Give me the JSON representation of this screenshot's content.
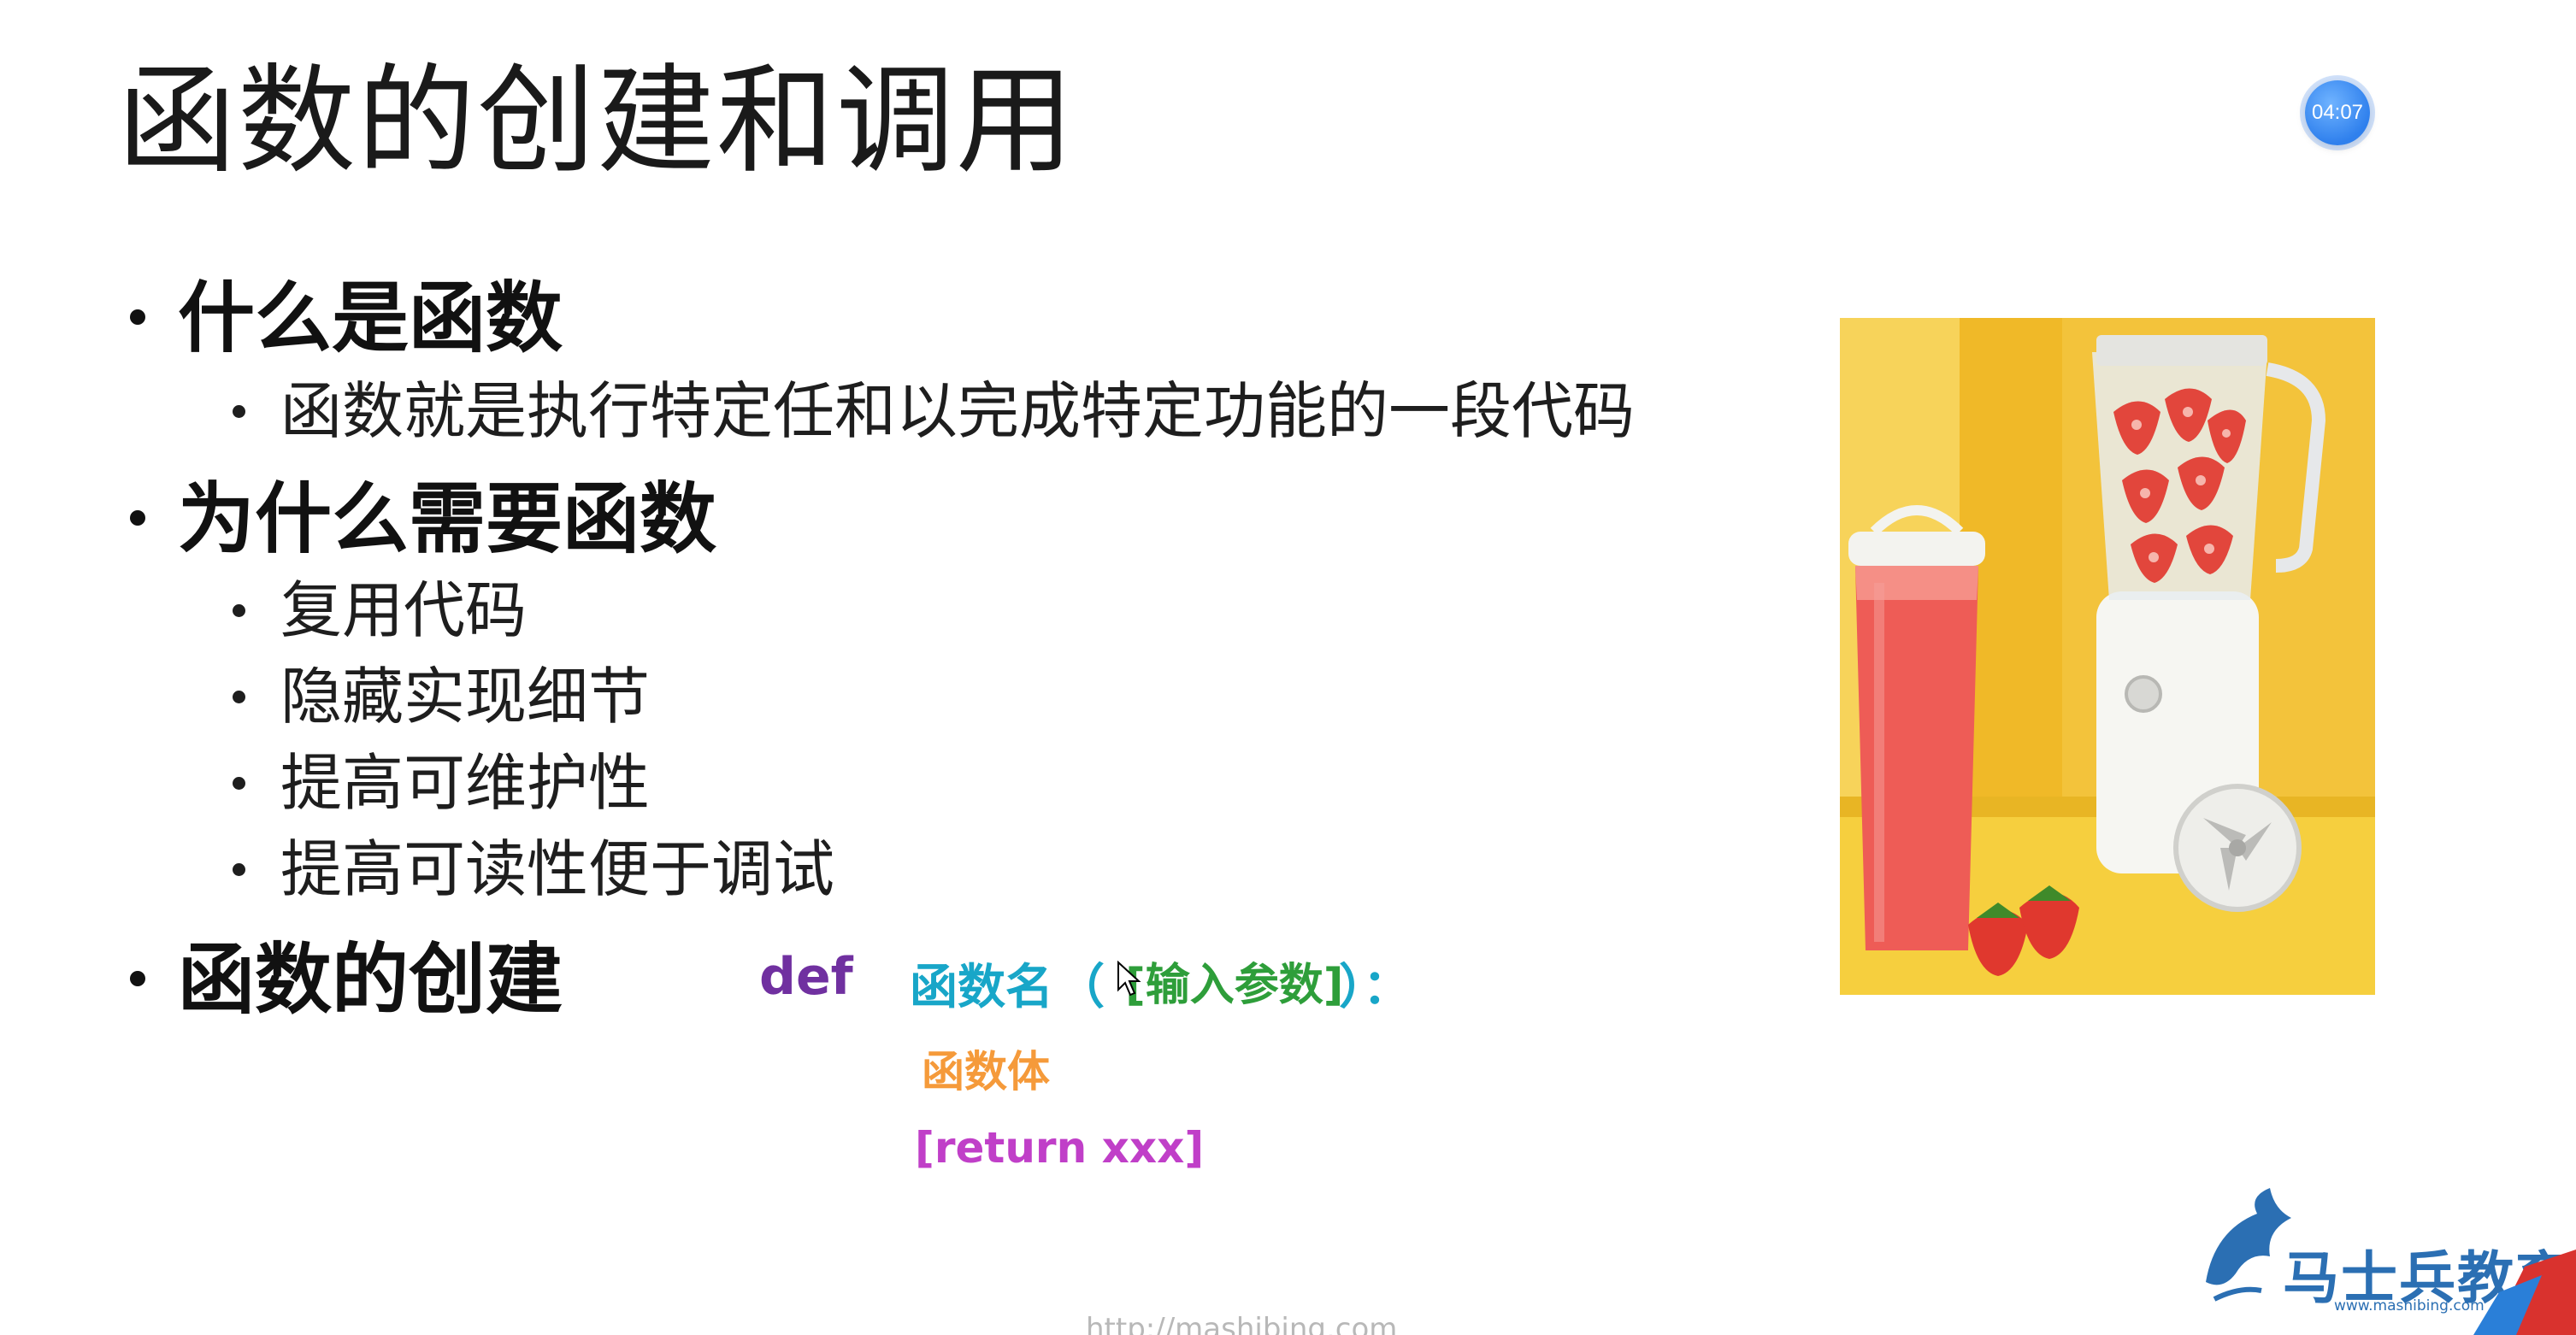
{
  "slide": {
    "title": "函数的创建和调用",
    "timer": "04:07",
    "bullets": [
      {
        "text": "什么是函数",
        "sub": [
          "函数就是执行特定任和以完成特定功能的一段代码"
        ]
      },
      {
        "text": "为什么需要函数",
        "sub": [
          "复用代码",
          "隐藏实现细节",
          "提高可维护性",
          "提高可读性便于调试"
        ]
      },
      {
        "text": "函数的创建",
        "sub": []
      }
    ],
    "code": {
      "def_keyword": "def",
      "func_name": "函数名",
      "paren_open": "（",
      "params": "[输入参数]",
      "paren_close": "）：",
      "body": "函数体",
      "return_stmt": "[return xxx]"
    },
    "colors": {
      "def": "#7030a0",
      "func_name": "#18a6c8",
      "params": "#2e9e3a",
      "body": "#f59a3a",
      "return": "#c03fc8"
    },
    "image": {
      "icon": "blender-photo"
    },
    "logo": {
      "name": "马士兵教育",
      "url": "www.mashibing.com"
    },
    "footer_url": "http://mashibing.com"
  }
}
